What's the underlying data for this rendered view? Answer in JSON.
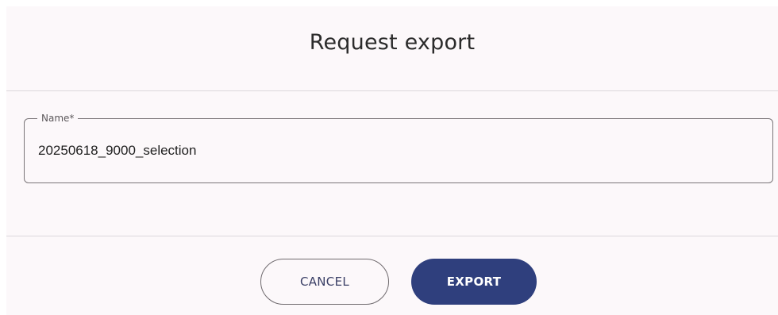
{
  "dialog": {
    "title": "Request export",
    "name_field": {
      "label": "Name*",
      "value": "20250618_9000_selection"
    },
    "buttons": {
      "cancel_label": "CANCEL",
      "export_label": "EXPORT"
    }
  },
  "colors": {
    "dialog_background": "#fcf8fa",
    "primary_button": "#2f3f7d",
    "divider": "#dcd7db"
  }
}
